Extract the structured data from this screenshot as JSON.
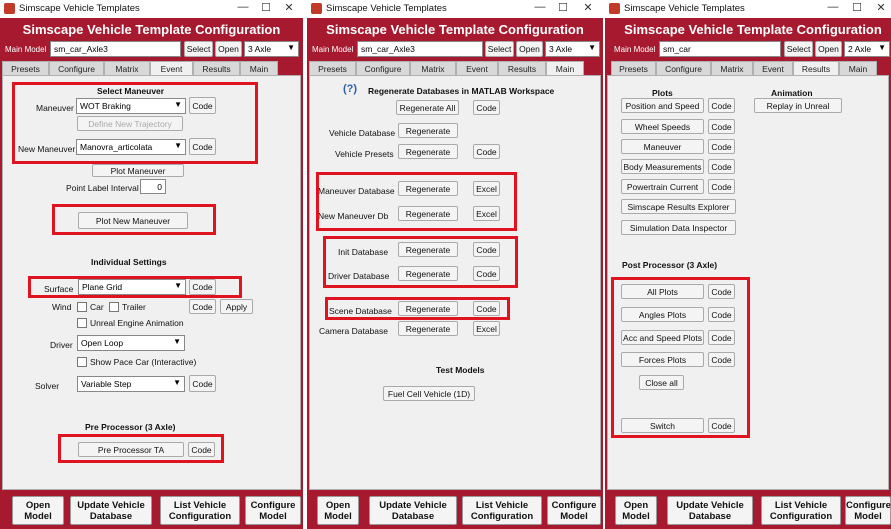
{
  "window_title": "Simscape Vehicle Templates",
  "app_title": "Simscape Vehicle Template Configuration",
  "main_model_label": "Main Model",
  "select_label": "Select",
  "open_label": "Open",
  "code_label": "Code",
  "regenerate_label": "Regenerate",
  "excel_label": "Excel",
  "title_controls": {
    "minimize": "—",
    "maximize": "☐",
    "close": "✕"
  },
  "tabs": [
    "Presets",
    "Configure",
    "Matrix",
    "Event",
    "Results",
    "Main"
  ],
  "bottom_buttons": [
    {
      "line1": "Open",
      "line2": "Model"
    },
    {
      "line1": "Update Vehicle",
      "line2": "Database"
    },
    {
      "line1": "List Vehicle",
      "line2": "Configuration"
    },
    {
      "line1": "Configure",
      "line2": "Model"
    }
  ],
  "w1": {
    "model": "sm_car_Axle3",
    "axle": "3 Axle",
    "active_tab": "Event",
    "select_maneuver_heading": "Select Maneuver",
    "maneuver_label": "Maneuver",
    "maneuver_value": "WOT Braking",
    "define_new_trajectory": "Define New Trajectory",
    "new_maneuver_label": "New Maneuver",
    "new_maneuver_value": "Manovra_articolata",
    "plot_maneuver": "Plot Maneuver",
    "point_label_interval": "Point Label Interval",
    "point_label_value": "0",
    "plot_new_maneuver": "Plot New Maneuver",
    "individual_settings": "Individual Settings",
    "surface_label": "Surface",
    "surface_value": "Plane Grid",
    "wind_label": "Wind",
    "car_label": "Car",
    "trailer_label": "Trailer",
    "apply_label": "Apply",
    "unreal_label": "Unreal Engine Animation",
    "driver_label": "Driver",
    "driver_value": "Open Loop",
    "pace_car_label": "Show Pace Car (Interactive)",
    "solver_label": "Solver",
    "solver_value": "Variable Step",
    "pre_processor_heading": "Pre Processor (3 Axle)",
    "pre_processor_button": "Pre Processor TA"
  },
  "w2": {
    "model": "sm_car_Axle3",
    "axle": "3 Axle",
    "active_tab": "Main",
    "help_mark": "(?)",
    "regen_heading": "Regenerate Databases in MATLAB Workspace",
    "regenerate_all": "Regenerate All",
    "rows": [
      {
        "label": "Vehicle Database",
        "has_side": false,
        "side": ""
      },
      {
        "label": "Vehicle Presets",
        "has_side": true,
        "side": "Code"
      },
      {
        "label": "Maneuver Database",
        "has_side": true,
        "side": "Excel"
      },
      {
        "label": "New Maneuver Db",
        "has_side": true,
        "side": "Excel"
      },
      {
        "label": "Init Database",
        "has_side": true,
        "side": "Code"
      },
      {
        "label": "Driver Database",
        "has_side": true,
        "side": "Code"
      },
      {
        "label": "Scene Database",
        "has_side": true,
        "side": "Code"
      },
      {
        "label": "Camera Database",
        "has_side": true,
        "side": "Excel"
      }
    ],
    "test_models_heading": "Test Models",
    "fuel_cell_button": "Fuel Cell Vehicle (1D)"
  },
  "w3": {
    "model": "sm_car",
    "axle": "2 Axle",
    "active_tab": "Results",
    "plots_heading": "Plots",
    "animation_heading": "Animation",
    "replay_unreal": "Replay in Unreal",
    "plot_buttons": [
      "Position and Speed",
      "Wheel Speeds",
      "Maneuver",
      "Body Measurements",
      "Powertrain Current"
    ],
    "results_explorer": "Simscape Results Explorer",
    "data_inspector": "Simulation Data Inspector",
    "post_processor_heading": "Post Processor (3 Axle)",
    "post_buttons": [
      "All Plots",
      "Angles Plots",
      "Acc and Speed Plots",
      "Forces Plots"
    ],
    "close_all": "Close all",
    "switch_label": "Switch"
  }
}
